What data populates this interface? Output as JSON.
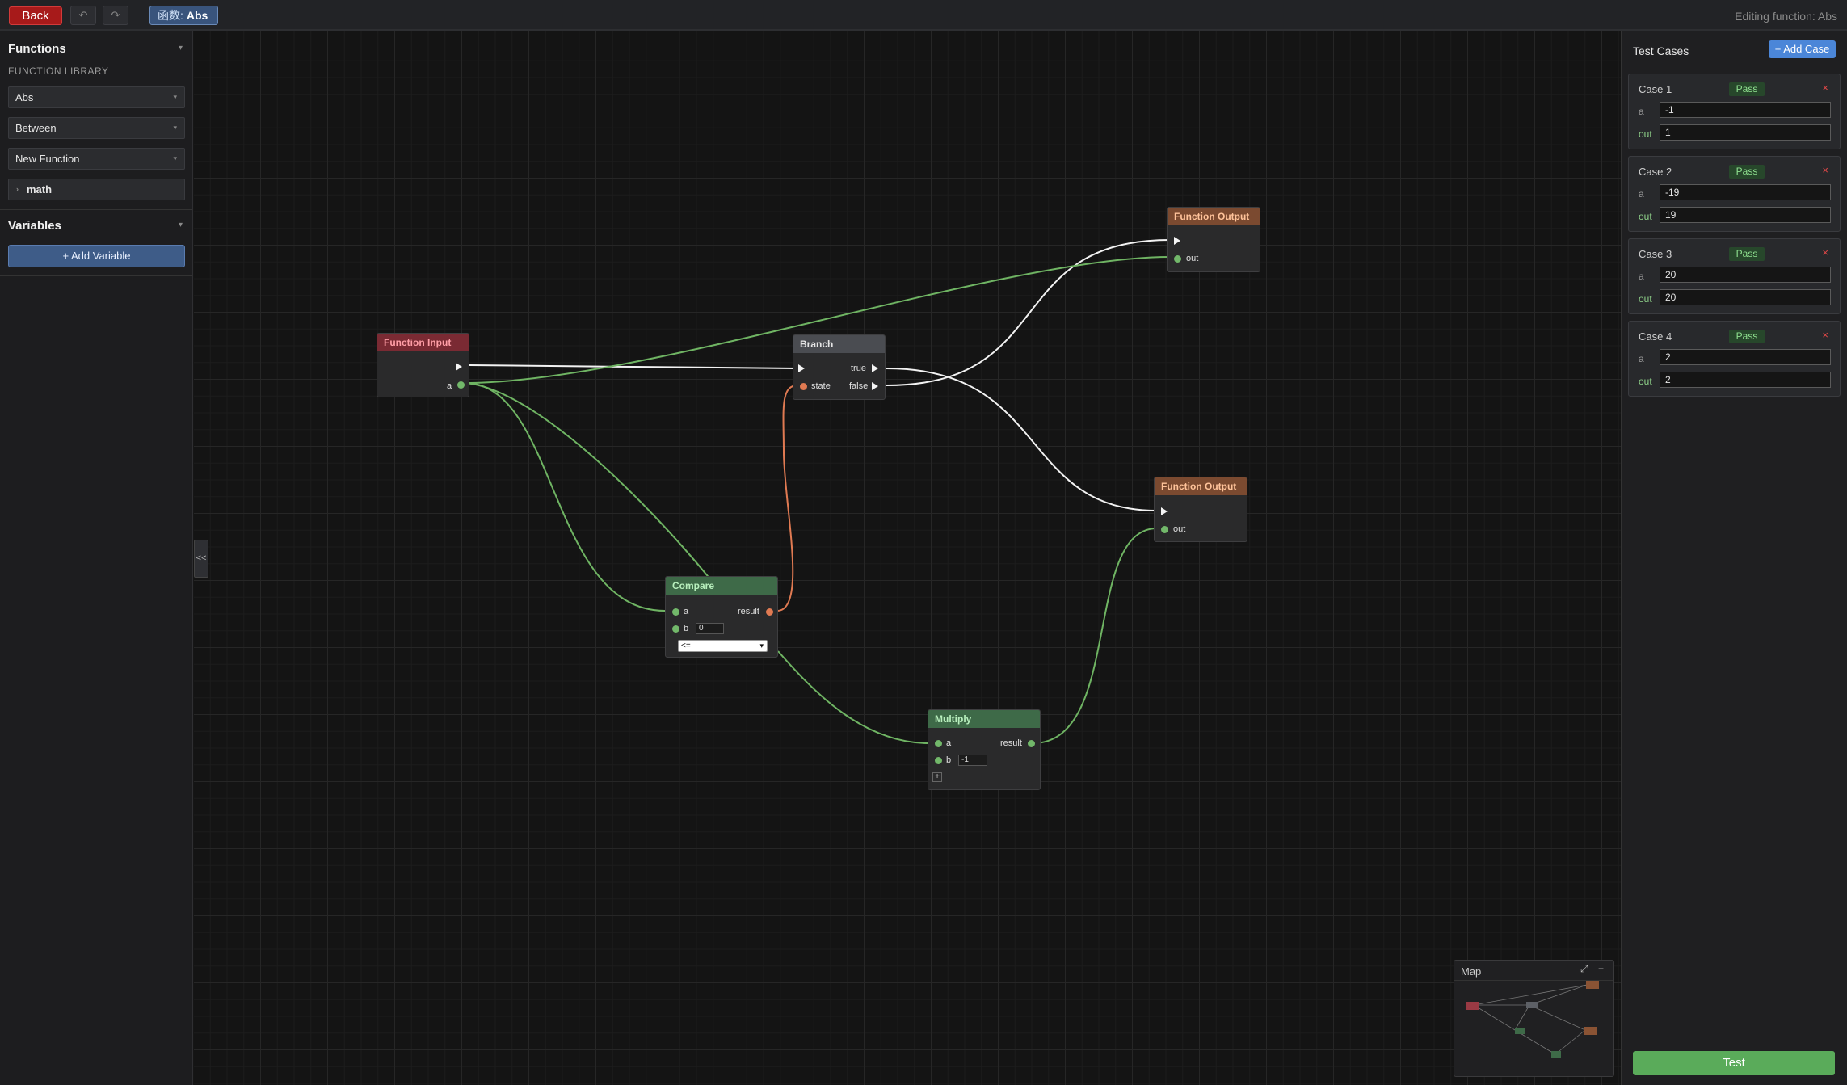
{
  "topbar": {
    "back_label": "Back",
    "undo_icon": "undo-icon",
    "redo_icon": "redo-icon",
    "chip_prefix": "函数:",
    "chip_name": "Abs",
    "editing_status": "Editing function: Abs"
  },
  "sidebar": {
    "functions_heading": "Functions",
    "library_label": "FUNCTION LIBRARY",
    "items": [
      {
        "label": "Abs"
      },
      {
        "label": "Between"
      },
      {
        "label": "New Function"
      }
    ],
    "folder": {
      "label": "math"
    },
    "variables_heading": "Variables",
    "add_variable_label": "+ Add Variable",
    "collapse_label": "<<"
  },
  "nodes": {
    "function_input": {
      "title": "Function Input",
      "pin_a": "a"
    },
    "branch": {
      "title": "Branch",
      "pin_state": "state",
      "pin_true": "true",
      "pin_false": "false"
    },
    "compare": {
      "title": "Compare",
      "pin_a": "a",
      "pin_b": "b",
      "b_value": "0",
      "pin_result": "result",
      "operator": "<="
    },
    "multiply": {
      "title": "Multiply",
      "pin_a": "a",
      "pin_b": "b",
      "b_value": "-1",
      "pin_result": "result",
      "add_pin": "+"
    },
    "output_top": {
      "title": "Function Output",
      "pin_out": "out"
    },
    "output_bottom": {
      "title": "Function Output",
      "pin_out": "out"
    }
  },
  "test_cases": {
    "title": "Test Cases",
    "add_label": "+ Add Case",
    "close_glyph": "×",
    "cases": [
      {
        "name": "Case 1",
        "status": "Pass",
        "a_label": "a",
        "a_value": "-1",
        "out_label": "out",
        "out_value": "1"
      },
      {
        "name": "Case 2",
        "status": "Pass",
        "a_label": "a",
        "a_value": "-19",
        "out_label": "out",
        "out_value": "19"
      },
      {
        "name": "Case 3",
        "status": "Pass",
        "a_label": "a",
        "a_value": "20",
        "out_label": "out",
        "out_value": "20"
      },
      {
        "name": "Case 4",
        "status": "Pass",
        "a_label": "a",
        "a_value": "2",
        "out_label": "out",
        "out_value": "2"
      }
    ],
    "test_label": "Test"
  },
  "minimap": {
    "title": "Map",
    "expand_glyph": "⤢",
    "minimize_glyph": "−"
  },
  "colors": {
    "exec_wire": "#f2f2f2",
    "data_wire": "#6fb463",
    "bool_wire": "#e07a52",
    "pass_text": "#8fe08f",
    "back_button": "#a71a1a",
    "accent_blue": "#4b86d8"
  }
}
